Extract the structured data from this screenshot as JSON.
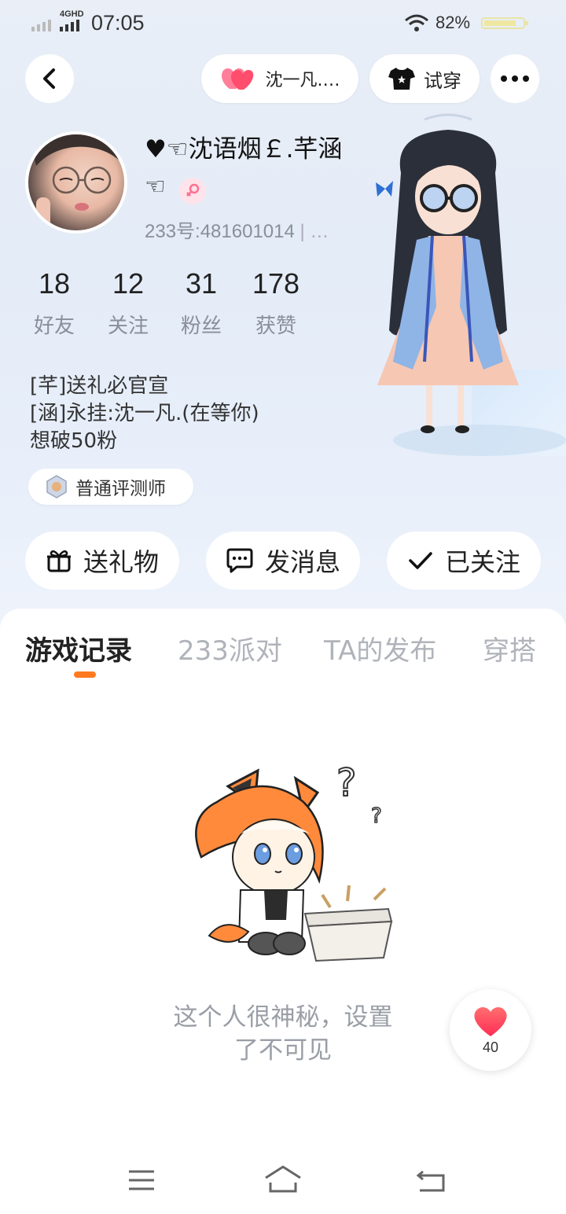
{
  "status_bar": {
    "network": "4GHD",
    "time": "07:05",
    "battery": "82%"
  },
  "top_bar": {
    "back_icon": "chevron-left-icon",
    "cp_name": "沈一凡.…",
    "try_on_label": "试穿",
    "more_icon": "more-dots-icon"
  },
  "profile": {
    "name": "♥☜沈语烟￡.芊涵",
    "emoji": "☜",
    "gender_icon": "female-icon",
    "id_text": "233号:481601014",
    "id_more": "| …"
  },
  "stats": [
    {
      "value": "18",
      "label": "好友"
    },
    {
      "value": "12",
      "label": "关注"
    },
    {
      "value": "31",
      "label": "粉丝"
    },
    {
      "value": "178",
      "label": "获赞"
    }
  ],
  "bio": [
    "[芊]送礼必官宣",
    "[涵]永挂:沈一凡.(在等你)",
    "想破50粉"
  ],
  "badge": {
    "label": "普通评测师"
  },
  "actions": {
    "gift": "送礼物",
    "message": "发消息",
    "follow": "已关注"
  },
  "tabs": [
    "游戏记录",
    "233派对",
    "TA的发布",
    "穿搭"
  ],
  "active_tab": 0,
  "empty_state": {
    "line1": "这个人很神秘，设置",
    "line2": "了不可见"
  },
  "like": {
    "count": "40"
  },
  "colors": {
    "accent": "#ff7a1f",
    "heart": "#ff3d55",
    "pink_heart": "#ff5c7a"
  }
}
